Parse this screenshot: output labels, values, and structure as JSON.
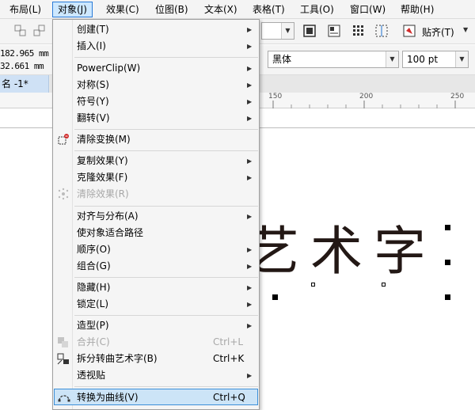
{
  "menubar": {
    "items": [
      {
        "label": "布局(L)"
      },
      {
        "label": "对象(J)"
      },
      {
        "label": "效果(C)"
      },
      {
        "label": "位图(B)"
      },
      {
        "label": "文本(X)"
      },
      {
        "label": "表格(T)"
      },
      {
        "label": "工具(O)"
      },
      {
        "label": "窗口(W)"
      },
      {
        "label": "帮助(H)"
      }
    ]
  },
  "toolbar": {
    "snap_label": "贴齐(T)"
  },
  "propbar": {
    "x_value": "182.965 mm",
    "y_value": "32.661 mm",
    "font_name": "黑体",
    "font_size": "100 pt"
  },
  "tabs": {
    "document_tab": "名 -1*",
    "add_tab": "+"
  },
  "ruler": {
    "ticks": [
      "150",
      "200",
      "250"
    ]
  },
  "canvas": {
    "art_text": "艺术字"
  },
  "object_menu": {
    "items": [
      {
        "label": "创建(T)"
      },
      {
        "label": "插入(I)"
      },
      {
        "label": "PowerClip(W)"
      },
      {
        "label": "对称(S)"
      },
      {
        "label": "符号(Y)"
      },
      {
        "label": "翻转(V)"
      },
      {
        "label": "清除变换(M)"
      },
      {
        "label": "复制效果(Y)"
      },
      {
        "label": "克隆效果(F)"
      },
      {
        "label": "清除效果(R)"
      },
      {
        "label": "对齐与分布(A)"
      },
      {
        "label": "使对象适合路径"
      },
      {
        "label": "顺序(O)"
      },
      {
        "label": "组合(G)"
      },
      {
        "label": "隐藏(H)"
      },
      {
        "label": "锁定(L)"
      },
      {
        "label": "造型(P)"
      },
      {
        "label": "合并(C)",
        "shortcut": "Ctrl+L"
      },
      {
        "label": "拆分转曲艺术字(B)",
        "shortcut": "Ctrl+K"
      },
      {
        "label": "透视贴"
      },
      {
        "label": "转换为曲线(V)",
        "shortcut": "Ctrl+Q"
      }
    ]
  },
  "colors": {
    "menu_highlight": "#cce4f7",
    "menu_highlight_border": "#3b8fd8",
    "active_menu": "#cde8ff",
    "tab_active": "#cfe1f5",
    "art_text": "#231815"
  }
}
